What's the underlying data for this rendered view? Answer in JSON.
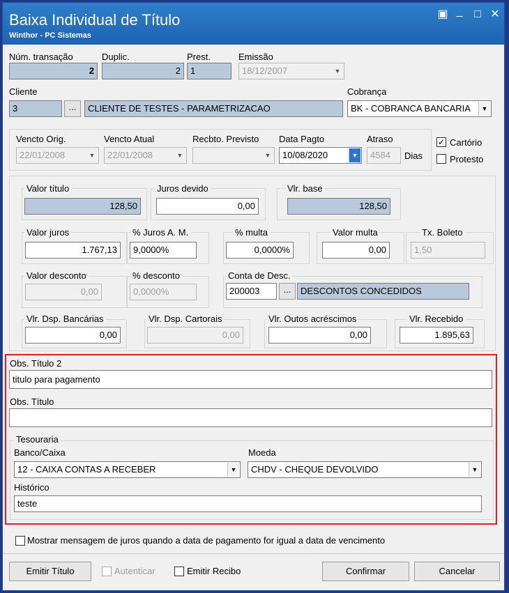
{
  "window": {
    "title": "Baixa Individual de Título",
    "subtitle": "Winthor - PC Sistemas",
    "icon_restore": "▣",
    "icon_minimize": "_",
    "icon_maximize": "□",
    "icon_close": "✕"
  },
  "header": {
    "num_transacao_label": "Núm. transação",
    "num_transacao_value": "2",
    "duplic_label": "Duplic.",
    "duplic_value": "2",
    "prest_label": "Prest.",
    "prest_value": "1",
    "emissao_label": "Emissão",
    "emissao_value": "18/12/2007"
  },
  "cliente": {
    "label": "Cliente",
    "code": "3",
    "lookup_button": "...",
    "name": "CLIENTE DE TESTES - PARAMETRIZACAO",
    "cobranca_label": "Cobrança",
    "cobranca_value": "BK - COBRANCA BANCARIA"
  },
  "dates": {
    "vencto_orig_label": "Vencto Orig.",
    "vencto_orig_value": "22/01/2008",
    "vencto_atual_label": "Vencto Atual",
    "vencto_atual_value": "22/01/2008",
    "recbto_previsto_label": "Recbto. Previsto",
    "recbto_previsto_value": "",
    "data_pagto_label": "Data Pagto",
    "data_pagto_value": "10/08/2020",
    "atraso_label": "Atraso",
    "atraso_value": "4584",
    "dias_label": "Dias",
    "cartorio_label": "Cartório",
    "cartorio_checked": "✓",
    "protesto_label": "Protesto"
  },
  "valores": {
    "valor_titulo_label": "Valor título",
    "valor_titulo_value": "128,50",
    "juros_devido_label": "Juros devido",
    "juros_devido_value": "0,00",
    "vlr_base_label": "Vlr. base",
    "vlr_base_value": "128,50",
    "valor_juros_label": "Valor juros",
    "valor_juros_value": "1.767,13",
    "pct_juros_label": "% Juros A. M.",
    "pct_juros_value": "9,0000%",
    "pct_multa_label": "% multa",
    "pct_multa_value": "0,0000%",
    "valor_multa_label": "Valor multa",
    "valor_multa_value": "0,00",
    "tx_boleto_label": "Tx. Boleto",
    "tx_boleto_value": "1,50",
    "valor_desconto_label": "Valor desconto",
    "valor_desconto_value": "0,00",
    "pct_desconto_label": "% desconto",
    "pct_desconto_value": "0,0000%",
    "conta_desc_label": "Conta de Desc.",
    "conta_desc_code": "200003",
    "conta_desc_button": "...",
    "conta_desc_name": "DESCONTOS CONCEDIDOS",
    "vlr_dsp_bancarias_label": "Vlr. Dsp. Bancárias",
    "vlr_dsp_bancarias_value": "0,00",
    "vlr_dsp_cartorais_label": "Vlr. Dsp. Cartorais",
    "vlr_dsp_cartorais_value": "0,00",
    "vlr_outros_label": "Vlr. Outos acréscimos",
    "vlr_outros_value": "0,00",
    "vlr_recebido_label": "Vlr. Recebido",
    "vlr_recebido_value": "1.895,63"
  },
  "obs": {
    "obs_titulo2_label": "Obs. Título 2",
    "obs_titulo2_value": "titulo para pagamento",
    "obs_titulo_label": "Obs. Título",
    "obs_titulo_value": ""
  },
  "tesouraria": {
    "group_label": "Tesouraria",
    "banco_label": "Banco/Caixa",
    "banco_value": "12 - CAIXA CONTAS A RECEBER",
    "moeda_label": "Moeda",
    "moeda_value": "CHDV - CHEQUE DEVOLVIDO",
    "historico_label": "Histórico",
    "historico_value": "teste"
  },
  "mostrar_msg_label": "Mostrar mensagem de juros quando a data de pagamento for igual a data de vencimento",
  "footer": {
    "emitir_titulo": "Emitir Título",
    "autenticar": "Autenticar",
    "emitir_recibo": "Emitir Recibo",
    "confirmar": "Confirmar",
    "cancelar": "Cancelar"
  },
  "colors": {
    "titlebar": "#1f62b3",
    "highlight_border": "#e02020",
    "readonly_field": "#b9c9dc"
  }
}
